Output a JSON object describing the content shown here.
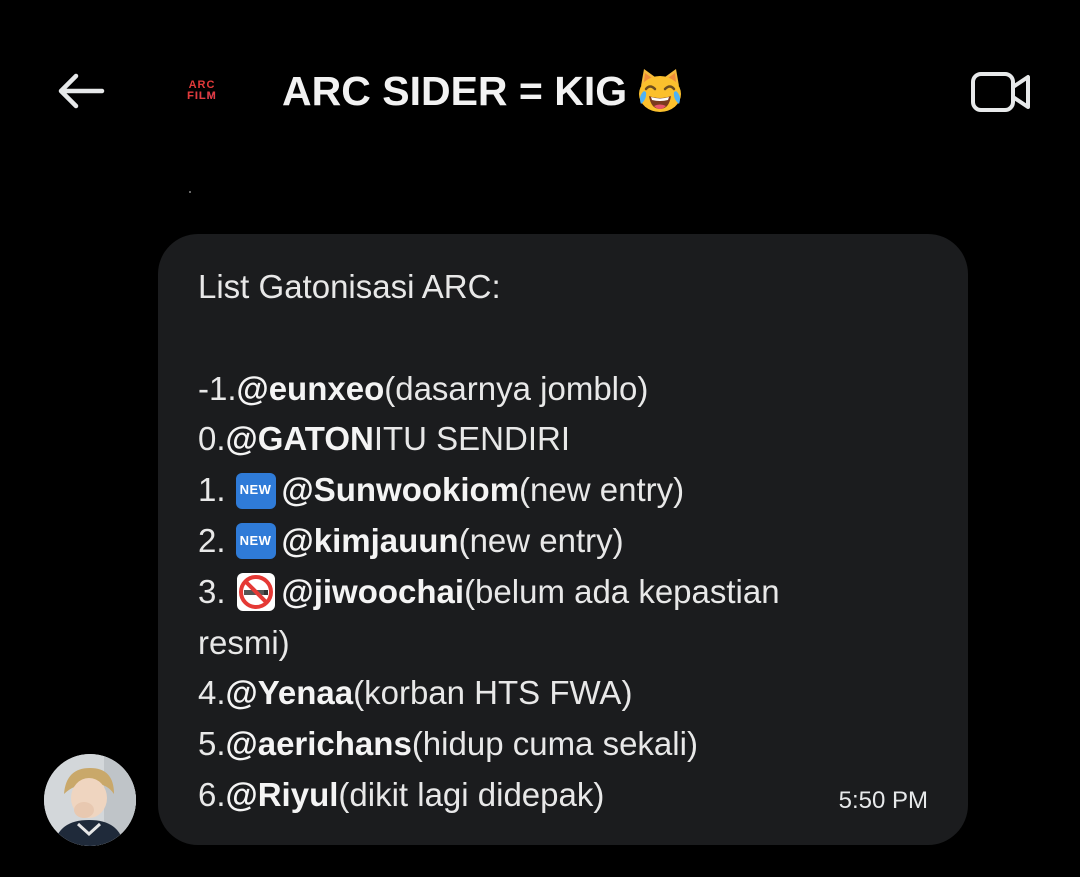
{
  "header": {
    "back_icon": "arrow-left-icon",
    "group_avatar": {
      "line1": "ARC",
      "line2": "FILM"
    },
    "title": "ARC SIDER = KIG",
    "title_emoji": "cat-with-tears-of-joy",
    "video_icon": "video-camera-icon"
  },
  "message": {
    "heading": "List Gatonisasi ARC:",
    "entries": [
      {
        "prefix": "-1. ",
        "badge": "",
        "mention": "@eunxeo",
        "suffix": " (dasarnya jomblo)"
      },
      {
        "prefix": "0. ",
        "badge": "",
        "mention": "@GATON",
        "suffix": " ITU SENDIRI"
      },
      {
        "prefix": "1.",
        "badge": "NEW",
        "mention": "@Sunwookiom",
        "suffix": " (new entry)"
      },
      {
        "prefix": "2.",
        "badge": "NEW",
        "mention": "@kimjauun",
        "suffix": " (new entry)"
      },
      {
        "prefix": "3.",
        "badge": "no-smoking",
        "mention": "@jiwoochai",
        "suffix": " (belum ada kepastian"
      },
      {
        "prefix": "resmi)",
        "badge": "",
        "mention": "",
        "suffix": ""
      },
      {
        "prefix": "4. ",
        "badge": "",
        "mention": "@Yenaa",
        "suffix": " (korban HTS FWA)"
      },
      {
        "prefix": "5. ",
        "badge": "",
        "mention": "@aerichans",
        "suffix": " (hidup cuma sekali)"
      },
      {
        "prefix": "6. ",
        "badge": "",
        "mention": "@Riyul",
        "suffix": " (dikit lagi didepak)"
      }
    ],
    "timestamp": "5:50 PM"
  },
  "colors": {
    "background": "#000000",
    "bubble": "#1b1c1e",
    "text": "#e8e8e8",
    "new_badge": "#2f7bd8"
  }
}
